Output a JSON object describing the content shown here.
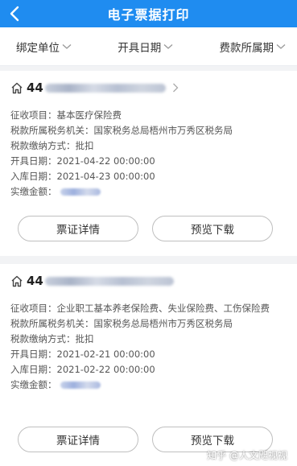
{
  "header": {
    "title": "电子票据打印",
    "back_icon": "chevron-left-icon"
  },
  "filters": [
    {
      "label": "绑定单位"
    },
    {
      "label": "开具日期"
    },
    {
      "label": "费款所属期"
    }
  ],
  "records": [
    {
      "id_prefix": "44",
      "fields": [
        {
          "label": "征收项目：",
          "value": "基本医疗保险费"
        },
        {
          "label": "税款所属税务机关：",
          "value": "国家税务总局梧州市万秀区税务局"
        },
        {
          "label": "税款缴纳方式：",
          "value": "批扣"
        },
        {
          "label": "开具日期：",
          "value": "2021-04-22 00:00:00"
        },
        {
          "label": "入库日期：",
          "value": "2021-04-23 00:00:00"
        },
        {
          "label": "实缴金额：",
          "value": ""
        }
      ],
      "detail_button": "票证详情",
      "download_button": "预览下载"
    },
    {
      "id_prefix": "44",
      "fields": [
        {
          "label": "征收项目：",
          "value": "企业职工基本养老保险费、失业保险费、工伤保险费"
        },
        {
          "label": "税款所属税务机关：",
          "value": "国家税务总局梧州市万秀区税务局"
        },
        {
          "label": "税款缴纳方式：",
          "value": "批扣"
        },
        {
          "label": "开具日期：",
          "value": "2021-02-21 00:00:00"
        },
        {
          "label": "入库日期：",
          "value": "2021-02-22 00:00:00"
        },
        {
          "label": "实缴金额：",
          "value": ""
        }
      ],
      "detail_button": "票证详情",
      "download_button": "预览下载"
    }
  ],
  "watermark": "知乎 @人文咫视视",
  "colors": {
    "header_bg": "#1f8cf0",
    "page_bg": "#f2f3f5"
  }
}
